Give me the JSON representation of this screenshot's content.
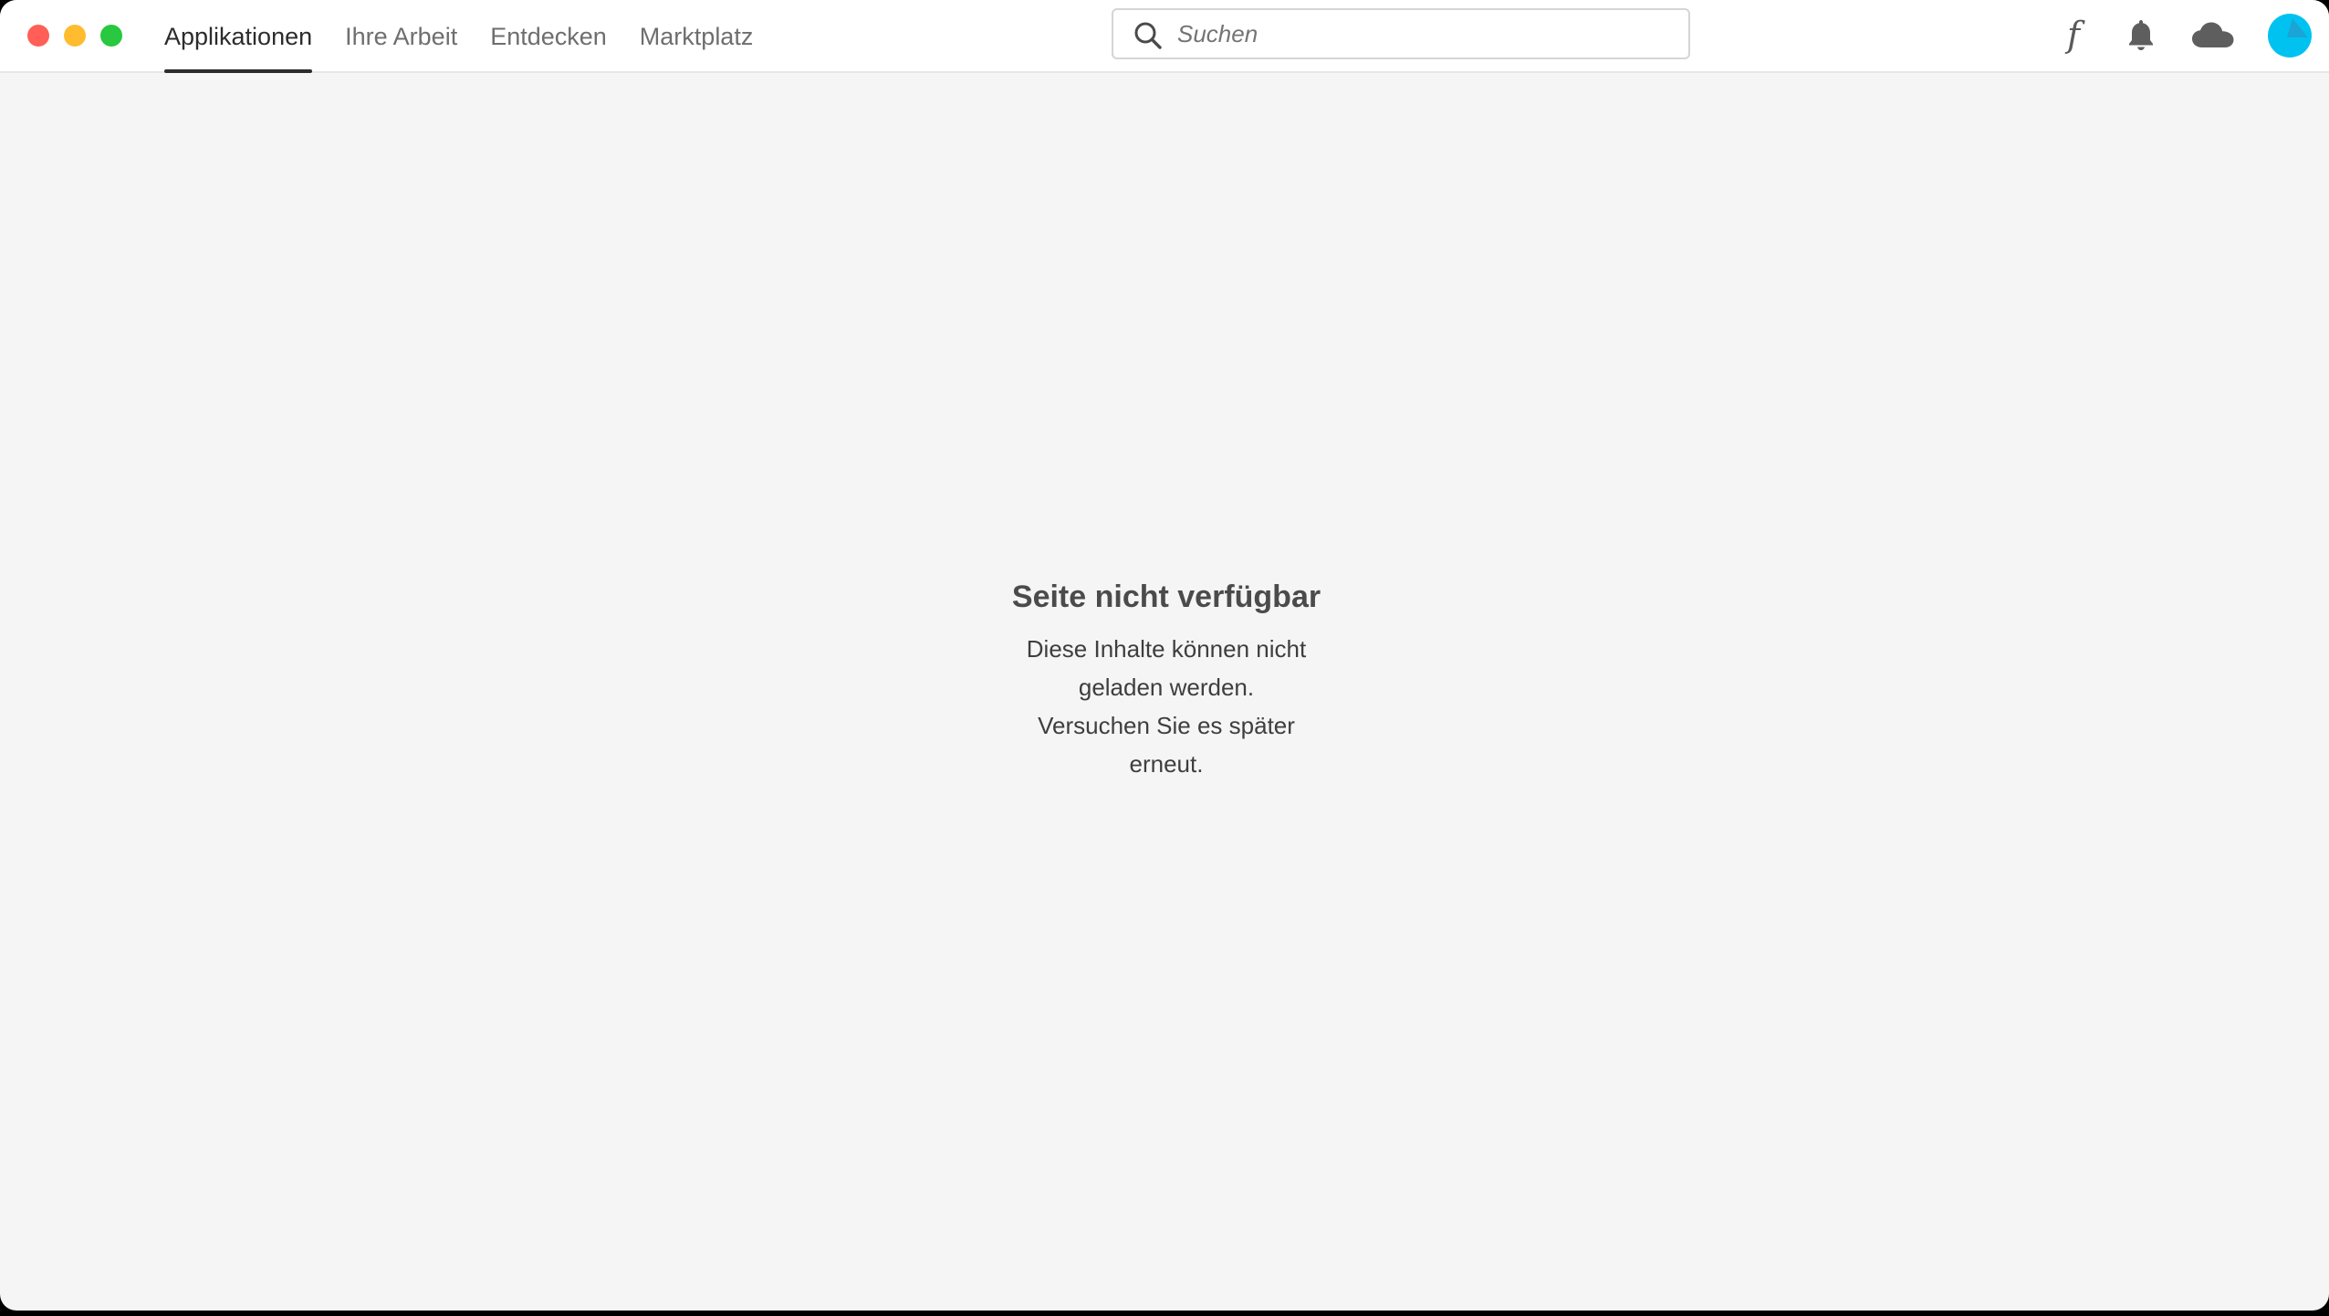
{
  "nav": {
    "tabs": [
      {
        "label": "Applikationen",
        "active": true
      },
      {
        "label": "Ihre Arbeit",
        "active": false
      },
      {
        "label": "Entdecken",
        "active": false
      },
      {
        "label": "Marktplatz",
        "active": false
      }
    ]
  },
  "search": {
    "placeholder": "Suchen",
    "value": ""
  },
  "header_icons": {
    "fonts": "f",
    "bell": "bell-icon",
    "cloud": "cloud-icon",
    "avatar": "avatar-icon"
  },
  "main": {
    "title": "Seite nicht verfügbar",
    "message": "Diese Inhalte können nicht geladen werden. Versuchen Sie es später erneut."
  },
  "colors": {
    "close": "#ff5f57",
    "minimize": "#febc2e",
    "maximize": "#28c840",
    "avatar": "#00c2f0",
    "background": "#f5f5f5"
  }
}
